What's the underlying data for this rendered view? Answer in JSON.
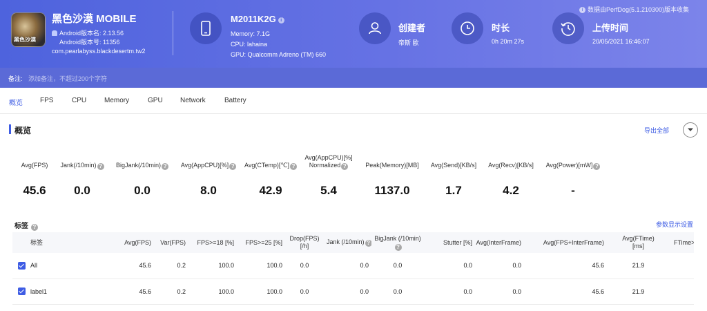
{
  "app": {
    "icon_text": "黑色沙漠",
    "name": "黑色沙漠 MOBILE",
    "version_name": "Android版本名: 2.13.56",
    "version_code": "Android版本号: 11356",
    "package": "com.pearlabyss.blackdesertm.tw2"
  },
  "device": {
    "model": "M2011K2G",
    "memory": "Memory: 7.1G",
    "cpu": "CPU: lahaina",
    "gpu": "GPU: Qualcomm Adreno (TM) 660"
  },
  "creator": {
    "title": "创建者",
    "value": "帝斯 歐"
  },
  "duration": {
    "title": "时长",
    "value": "0h 20m 27s"
  },
  "upload": {
    "title": "上传时间",
    "value": "20/05/2021 16:46:07"
  },
  "source_note": "数据由PerfDog(5.1.210300)版本收集",
  "note": {
    "label": "备注:",
    "placeholder": "添加备注，不超过200个字符"
  },
  "tabs": [
    "概览",
    "FPS",
    "CPU",
    "Memory",
    "GPU",
    "Network",
    "Battery"
  ],
  "active_tab": "概览",
  "overview": {
    "title": "概览",
    "export_label": "导出全部",
    "metrics": [
      {
        "label": "Avg(FPS)",
        "value": "45.6"
      },
      {
        "label": "Jank(/10min)",
        "value": "0.0"
      },
      {
        "label": "BigJank(/10min)",
        "value": "0.0"
      },
      {
        "label": "Avg(AppCPU)[%]",
        "value": "8.0"
      },
      {
        "label": "Avg(CTemp)[℃]",
        "value": "42.9"
      },
      {
        "label1": "Avg(AppCPU)[%]",
        "label2": "Normalized",
        "value": "5.4"
      },
      {
        "label": "Peak(Memory)[MB]",
        "value": "1137.0"
      },
      {
        "label": "Avg(Send)[KB/s]",
        "value": "1.7"
      },
      {
        "label": "Avg(Recv)[KB/s]",
        "value": "4.2"
      },
      {
        "label": "Avg(Power)[mW]",
        "value": "-"
      }
    ]
  },
  "tags": {
    "title": "标签",
    "param_settings": "参数显示设置",
    "columns": [
      "标签",
      "Avg(FPS)",
      "Var(FPS)",
      "FPS>=18 [%]",
      "FPS>=25 [%]",
      "Drop(FPS)",
      "[/h]",
      "Jank (/10min)",
      "BigJank (/10min)",
      "Stutter [%]",
      "Avg(InterFrame)",
      "Avg(FPS+InterFrame)",
      "Avg(FTime)",
      "[ms]",
      "FTime>"
    ],
    "rows": [
      {
        "label": "All",
        "cells": [
          "45.6",
          "0.2",
          "100.0",
          "100.0",
          "0.0",
          "0.0",
          "0.0",
          "0.0",
          "0.0",
          "45.6",
          "21.9"
        ]
      },
      {
        "label": "label1",
        "cells": [
          "45.6",
          "0.2",
          "100.0",
          "100.0",
          "0.0",
          "0.0",
          "0.0",
          "0.0",
          "0.0",
          "45.6",
          "21.9"
        ]
      }
    ]
  },
  "colors": {
    "header_start": "#4e63dd",
    "header_end": "#7c84ea",
    "accent": "#3e5ce4"
  }
}
